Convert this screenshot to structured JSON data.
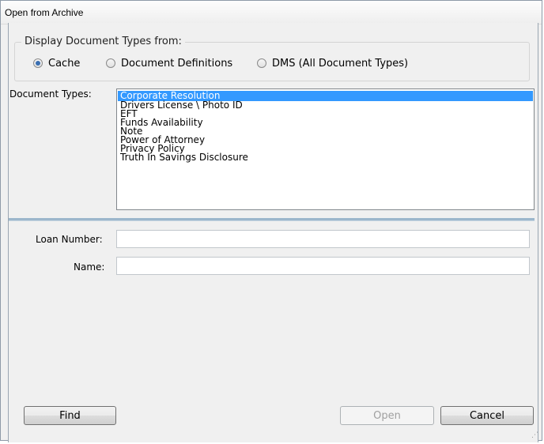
{
  "window": {
    "title": "Open from Archive"
  },
  "display_types": {
    "legend": "Display Document Types from:",
    "options": [
      {
        "label": "Cache",
        "checked": true
      },
      {
        "label": "Document Definitions",
        "checked": false
      },
      {
        "label": "DMS (All Document Types)",
        "checked": false
      }
    ]
  },
  "document_types": {
    "label": "Document Types:",
    "items": [
      "Corporate Resolution",
      "Drivers License \\ Photo ID",
      "EFT",
      "Funds Availability",
      "Note",
      "Power of Attorney",
      "Privacy Policy",
      "Truth In Savings Disclosure"
    ],
    "selected": "Corporate Resolution"
  },
  "fields": {
    "loan_number": {
      "label": "Loan Number:",
      "value": ""
    },
    "name": {
      "label": "Name:",
      "value": ""
    }
  },
  "buttons": {
    "find": "Find",
    "open": "Open",
    "cancel": "Cancel"
  },
  "colors": {
    "selection": "#3399ff",
    "separator": "#9cb6cc",
    "radio_dot": "#3a6fb2"
  }
}
